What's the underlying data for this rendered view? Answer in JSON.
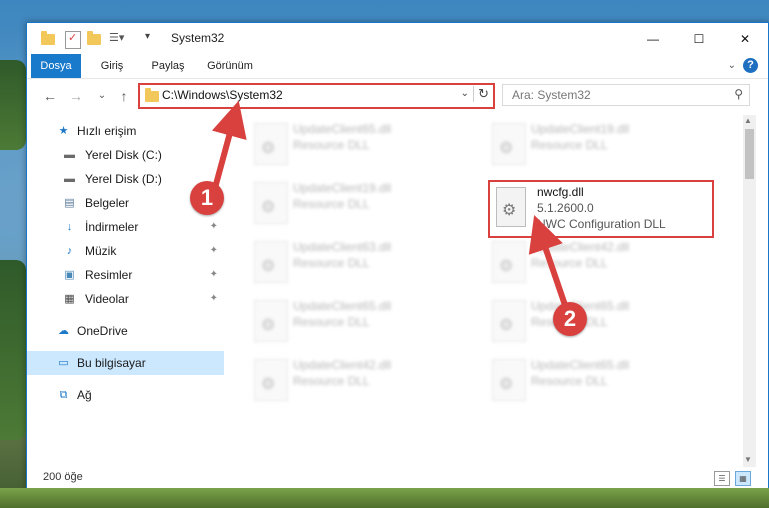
{
  "window": {
    "title": "System32",
    "minimize_glyph": "—",
    "maximize_glyph": "☐",
    "close_glyph": "✕"
  },
  "ribbon": {
    "tabs": [
      "Dosya",
      "Giriş",
      "Paylaş",
      "Görünüm"
    ],
    "active_tab": "Dosya",
    "help_glyph": "?",
    "collapse_glyph": "⌄"
  },
  "nav": {
    "back_glyph": "←",
    "forward_glyph": "→",
    "recent_glyph": "⌄",
    "up_glyph": "↑"
  },
  "address": {
    "path": "C:\\Windows\\System32",
    "dropdown_glyph": "⌄",
    "refresh_glyph": "↻"
  },
  "search": {
    "placeholder": "Ara: System32",
    "icon": "search-icon",
    "glyph": "⚲"
  },
  "sidebar": {
    "items": [
      {
        "label": "Hızlı erişim",
        "icon": "star-icon",
        "glyph": "★",
        "color": "#1e78c8"
      },
      {
        "label": "Yerel Disk (C:)",
        "icon": "drive-icon",
        "glyph": "▬",
        "color": "#6b6b6b"
      },
      {
        "label": "Yerel Disk (D:)",
        "icon": "drive-icon",
        "glyph": "▬",
        "color": "#6b6b6b"
      },
      {
        "label": "Belgeler",
        "icon": "documents-icon",
        "glyph": "▤",
        "color": "#5a7a9a",
        "pin": "📌"
      },
      {
        "label": "İndirmeler",
        "icon": "downloads-icon",
        "glyph": "↓",
        "color": "#1e78c8",
        "pin": "📌"
      },
      {
        "label": "Müzik",
        "icon": "music-icon",
        "glyph": "♪",
        "color": "#1e78c8",
        "pin": "📌"
      },
      {
        "label": "Resimler",
        "icon": "pictures-icon",
        "glyph": "▣",
        "color": "#4a8ab8",
        "pin": "📌"
      },
      {
        "label": "Videolar",
        "icon": "videos-icon",
        "glyph": "▦",
        "color": "#444",
        "pin": "📌"
      },
      {
        "label": "OneDrive",
        "icon": "cloud-icon",
        "glyph": "☁",
        "color": "#1e78c8"
      },
      {
        "label": "Bu bilgisayar",
        "icon": "computer-icon",
        "glyph": "▭",
        "color": "#1e78c8"
      },
      {
        "label": "Ağ",
        "icon": "network-icon",
        "glyph": "⧉",
        "color": "#1e78c8"
      }
    ]
  },
  "files": {
    "gear_glyph": "⚙",
    "left_column": [
      {
        "name": "UpdateClient65.dll",
        "desc": "Resource DLL"
      },
      {
        "name": "UpdateClient19.dll",
        "desc": "Resource DLL"
      },
      {
        "name": "UpdateClient63.dll",
        "desc": "Resource DLL"
      },
      {
        "name": "UpdateClient65.dll",
        "desc": "Resource DLL"
      },
      {
        "name": "UpdateClient42.dll",
        "desc": "Resource DLL"
      }
    ],
    "right_column": [
      {
        "name": "UpdateClient19.dll",
        "desc": "Resource DLL"
      },
      {
        "name": "UpdateClient42.dll",
        "desc": "Resource DLL"
      },
      {
        "name": "UpdateClient65.dll",
        "desc": "Resource DLL"
      },
      {
        "name": "UpdateClient65.dll",
        "desc": "Resource DLL"
      }
    ],
    "highlighted": {
      "name": "nwcfg.dll",
      "version": "5.1.2600.0",
      "description": "NWC Configuration DLL"
    }
  },
  "annotations": {
    "step1": "1",
    "step2": "2",
    "color": "#d9413f"
  },
  "status": {
    "count": "200 öğe",
    "details_view_glyph": "☰",
    "tiles_view_glyph": "▦"
  },
  "scrollbar": {
    "up_glyph": "▲",
    "down_glyph": "▼"
  }
}
